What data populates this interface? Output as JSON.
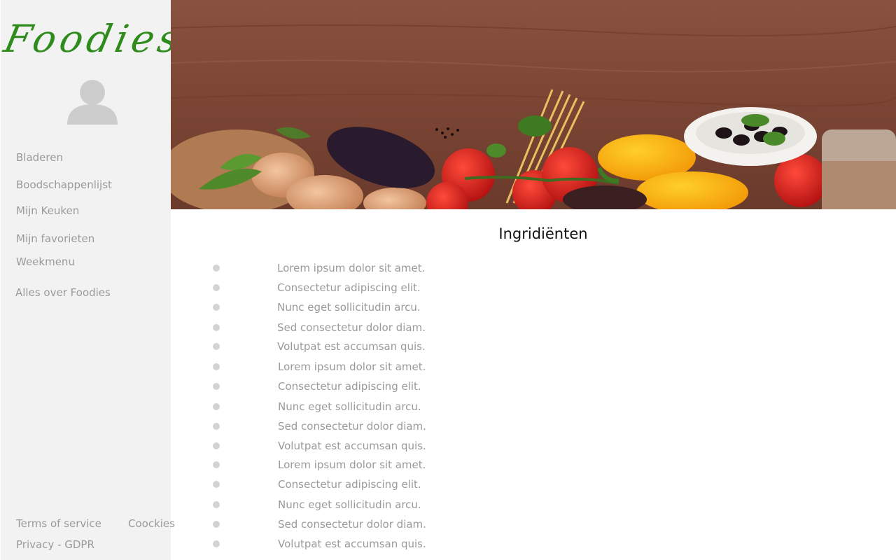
{
  "app": {
    "logo_text": "Foodies",
    "brand_color": "#2e8b1c"
  },
  "sidebar": {
    "avatar_icon": "user-avatar-icon",
    "items": [
      {
        "label": "Bladeren"
      },
      {
        "label": "Boodschappenlijst"
      },
      {
        "label": "Mijn Keuken"
      },
      {
        "label": "Mijn favorieten"
      },
      {
        "label": "Weekmenu"
      },
      {
        "label": "Alles over Foodies"
      }
    ],
    "footer": {
      "terms": "Terms of service",
      "cookies": "Coockies",
      "privacy": "Privacy - GDPR"
    }
  },
  "main": {
    "title": "Ingridiënten",
    "ingredients": [
      "Lorem ipsum dolor sit amet.",
      "Consectetur adipiscing elit.",
      "Nunc eget sollicitudin arcu.",
      "Sed consectetur dolor diam.",
      "Volutpat est accumsan quis.",
      "Lorem ipsum dolor sit amet.",
      "Consectetur adipiscing elit.",
      "Nunc eget sollicitudin arcu.",
      "Sed consectetur dolor diam.",
      "Volutpat est accumsan quis.",
      "Lorem ipsum dolor sit amet.",
      "Consectetur adipiscing elit.",
      "Nunc eget sollicitudin arcu.",
      "Sed consectetur dolor diam.",
      "Volutpat est accumsan quis."
    ]
  }
}
